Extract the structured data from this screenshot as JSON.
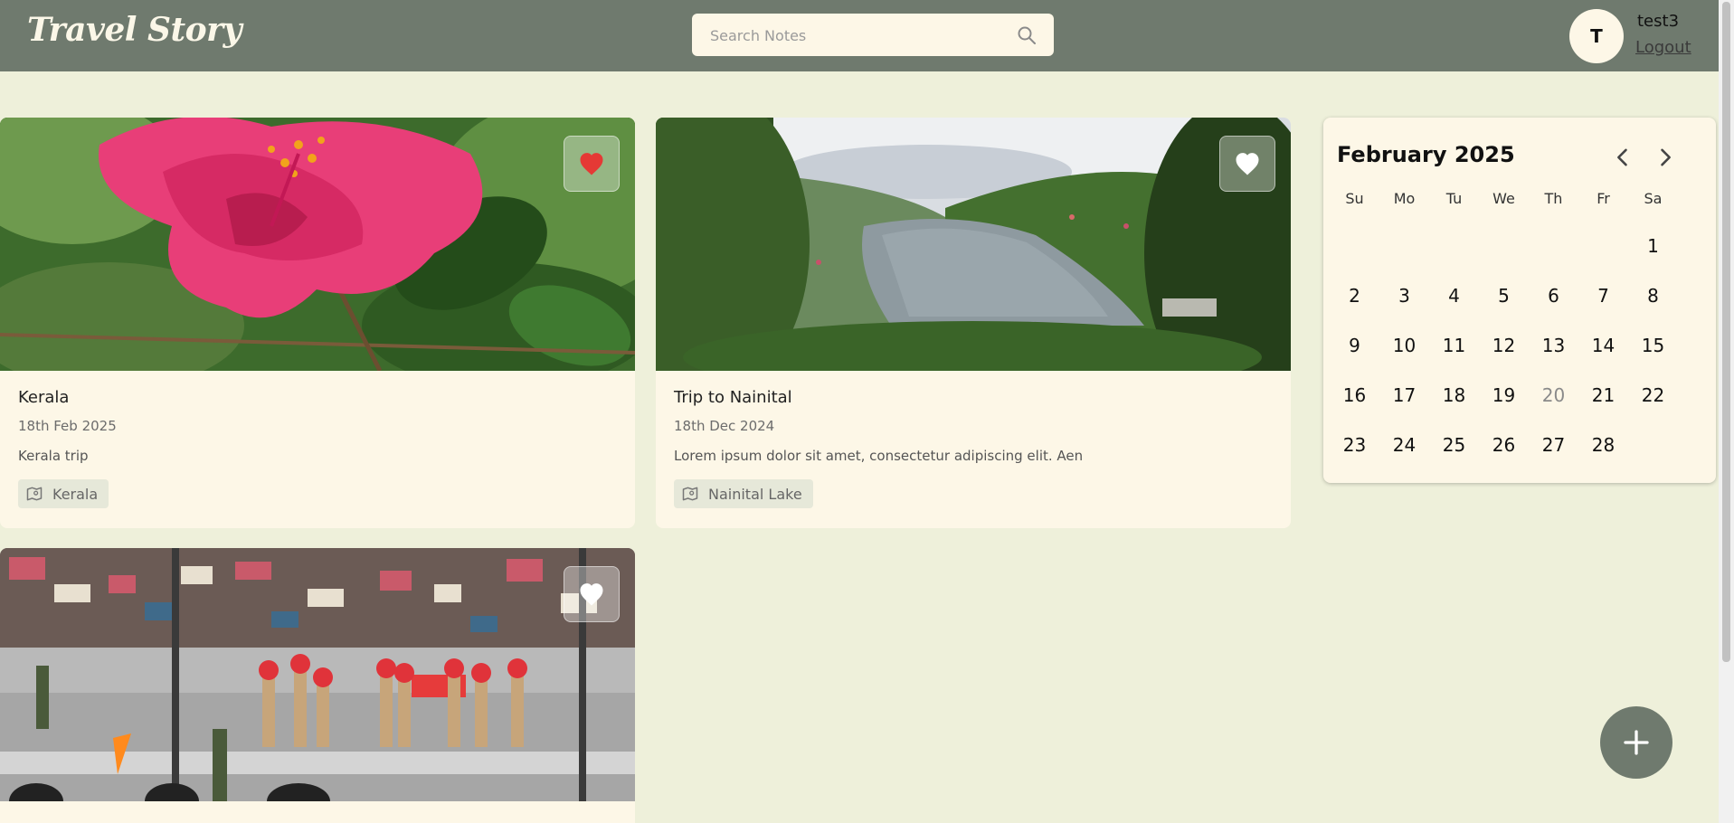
{
  "app": {
    "brand": "Travel Story"
  },
  "search": {
    "placeholder": "Search Notes",
    "value": ""
  },
  "user": {
    "initial": "T",
    "name": "test3",
    "logout_label": "Logout"
  },
  "cards": [
    {
      "title": "Kerala",
      "date": "18th Feb 2025",
      "description": "Kerala trip",
      "tag": "Kerala",
      "favorite": true,
      "image": "pink-hibiscus-flower"
    },
    {
      "title": "Trip to Nainital",
      "date": "18th Dec 2024",
      "description": "Lorem ipsum dolor sit amet, consectetur adipiscing elit. Aen",
      "tag": "Nainital Lake",
      "favorite": false,
      "image": "mountain-lake-valley"
    },
    {
      "title": "",
      "date": "",
      "description": "",
      "tag": "",
      "favorite": false,
      "image": "border-ceremony-parade"
    }
  ],
  "calendar": {
    "month": "February",
    "year": "2025",
    "weekdays": [
      "Su",
      "Mo",
      "Tu",
      "We",
      "Th",
      "Fr",
      "Sa"
    ],
    "days": [
      "1",
      "2",
      "3",
      "4",
      "5",
      "6",
      "7",
      "8",
      "9",
      "10",
      "11",
      "12",
      "13",
      "14",
      "15",
      "16",
      "17",
      "18",
      "19",
      "20",
      "21",
      "22",
      "23",
      "24",
      "25",
      "26",
      "27",
      "28"
    ],
    "today": "20"
  },
  "colors": {
    "navbar": "#6f7a6e",
    "background": "#eef0da",
    "card": "#fdf7e7",
    "favorite": "#e53935"
  },
  "fab": {
    "icon": "plus-icon"
  }
}
